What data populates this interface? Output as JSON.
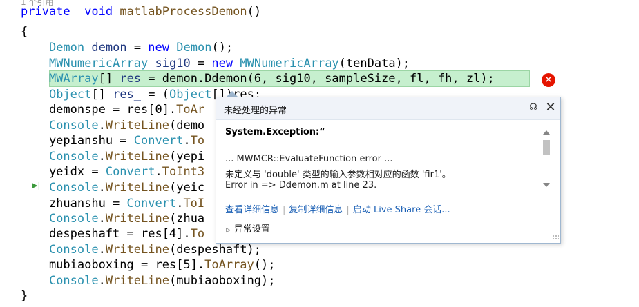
{
  "editor": {
    "codelens": "1 个引用",
    "lines": [
      {
        "id": "sig",
        "tokens": [
          [
            "k",
            "private"
          ],
          [
            "",
            "  "
          ],
          [
            "k",
            "void"
          ],
          [
            "",
            " "
          ],
          [
            "f",
            "matlabProcessDemon"
          ],
          [
            "",
            "()"
          ]
        ]
      },
      {
        "id": "open",
        "tokens": [
          [
            "",
            "{"
          ]
        ]
      },
      {
        "id": "l1",
        "tokens": [
          [
            "",
            "    "
          ],
          [
            "t",
            "Demon"
          ],
          [
            "",
            " "
          ],
          [
            "m",
            "demon"
          ],
          [
            "",
            " = "
          ],
          [
            "k",
            "new"
          ],
          [
            "",
            " "
          ],
          [
            "t",
            "Demon"
          ],
          [
            "",
            "();"
          ]
        ]
      },
      {
        "id": "l2",
        "tokens": [
          [
            "",
            "    "
          ],
          [
            "t",
            "MWNumericArray"
          ],
          [
            "",
            " "
          ],
          [
            "m",
            "sig10"
          ],
          [
            "",
            " = "
          ],
          [
            "k",
            "new"
          ],
          [
            "",
            " "
          ],
          [
            "t",
            "MWNumericArray"
          ],
          [
            "",
            "(tenData);"
          ]
        ]
      },
      {
        "id": "l3",
        "tokens": [
          [
            "",
            "    "
          ],
          [
            "t",
            "MWArray"
          ],
          [
            "",
            "[] "
          ],
          [
            "m",
            "res"
          ],
          [
            "",
            " = demon.Ddemon(6, sig10, sampleSize, fl, fh, zl);"
          ]
        ]
      },
      {
        "id": "l4",
        "tokens": [
          [
            "",
            "    "
          ],
          [
            "t",
            "Object"
          ],
          [
            "",
            "[] "
          ],
          [
            "m",
            "res_"
          ],
          [
            "",
            " = ("
          ],
          [
            "t",
            "Object"
          ],
          [
            "",
            "[])res;"
          ]
        ]
      },
      {
        "id": "l5",
        "tokens": [
          [
            "",
            "    demonspe = res[0]."
          ],
          [
            "f",
            "ToAr"
          ]
        ]
      },
      {
        "id": "l6",
        "tokens": [
          [
            "",
            "    "
          ],
          [
            "t",
            "Console"
          ],
          [
            "",
            "."
          ],
          [
            "f",
            "WriteLine"
          ],
          [
            "",
            "(demo"
          ]
        ]
      },
      {
        "id": "l7",
        "tokens": [
          [
            "",
            "    yepianshu = "
          ],
          [
            "t",
            "Convert"
          ],
          [
            "",
            "."
          ],
          [
            "f",
            "To"
          ]
        ]
      },
      {
        "id": "l8",
        "tokens": [
          [
            "",
            "    "
          ],
          [
            "t",
            "Console"
          ],
          [
            "",
            "."
          ],
          [
            "f",
            "WriteLine"
          ],
          [
            "",
            "(yepi"
          ]
        ]
      },
      {
        "id": "l9",
        "tokens": [
          [
            "",
            "    yeidx = "
          ],
          [
            "t",
            "Convert"
          ],
          [
            "",
            "."
          ],
          [
            "f",
            "ToInt3"
          ]
        ]
      },
      {
        "id": "l10",
        "tokens": [
          [
            "",
            "    "
          ],
          [
            "t",
            "Console"
          ],
          [
            "",
            "."
          ],
          [
            "f",
            "WriteLine"
          ],
          [
            "",
            "(yeic"
          ]
        ]
      },
      {
        "id": "l11",
        "tokens": [
          [
            "",
            "    zhuanshu = "
          ],
          [
            "t",
            "Convert"
          ],
          [
            "",
            "."
          ],
          [
            "f",
            "ToI"
          ]
        ]
      },
      {
        "id": "l12",
        "tokens": [
          [
            "",
            "    "
          ],
          [
            "t",
            "Console"
          ],
          [
            "",
            "."
          ],
          [
            "f",
            "WriteLine"
          ],
          [
            "",
            "(zhua"
          ]
        ]
      },
      {
        "id": "l13",
        "tokens": [
          [
            "",
            "    despeshaft = res[4]."
          ],
          [
            "f",
            "To"
          ]
        ]
      },
      {
        "id": "l14",
        "tokens": [
          [
            "",
            "    "
          ],
          [
            "t",
            "Console"
          ],
          [
            "",
            "."
          ],
          [
            "f",
            "WriteLine"
          ],
          [
            "",
            "(despeshaft);"
          ]
        ]
      },
      {
        "id": "l15",
        "tokens": [
          [
            "",
            "    mubiaoboxing = res[5]."
          ],
          [
            "f",
            "ToArray"
          ],
          [
            "",
            "();"
          ]
        ]
      },
      {
        "id": "l16",
        "tokens": [
          [
            "",
            "    "
          ],
          [
            "t",
            "Console"
          ],
          [
            "",
            "."
          ],
          [
            "f",
            "WriteLine"
          ],
          [
            "",
            "(mubiaoboxing);"
          ]
        ]
      },
      {
        "id": "close",
        "tokens": [
          [
            "",
            "}"
          ]
        ]
      }
    ],
    "current_line_arrow": "▶|"
  },
  "exception_popup": {
    "title": "未经处理的异常",
    "pin_icon": "pin-icon",
    "close_icon": "close-icon",
    "exception_type": "System.Exception:“",
    "message_lines": [
      "... MWMCR::EvaluateFunction error ...",
      "未定义与 'double' 类型的输入参数相对应的函数 'fir1'。",
      "Error in => Ddemon.m at line 23."
    ],
    "links": [
      "查看详细信息",
      "复制详细信息",
      "启动 Live Share 会话..."
    ],
    "settings_label": "异常设置"
  },
  "colors": {
    "keyword": "#0000ff",
    "type": "#2b91af",
    "highlight": "#c6efce",
    "error": "#e51400",
    "link": "#1a5fb4"
  }
}
